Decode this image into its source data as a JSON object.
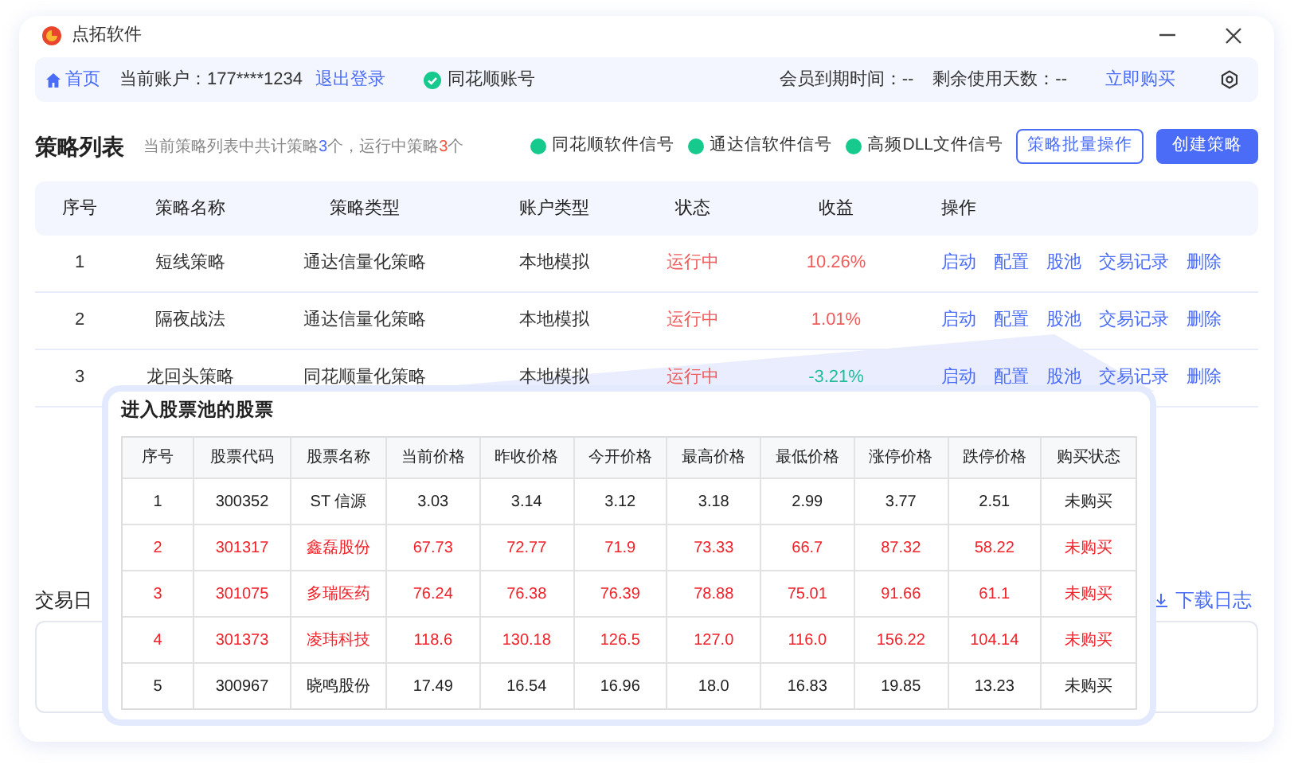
{
  "window": {
    "title": "点拓软件"
  },
  "nav": {
    "home": "首页",
    "account_label": "当前账户：",
    "account": "177****1234",
    "logout": "退出登录",
    "linked_account": "同花顺账号",
    "expiry": "会员到期时间：--",
    "remaining": "剩余使用天数：--",
    "buy": "立即购买"
  },
  "header": {
    "title": "策略列表",
    "summary": "当前策略列表中共计策略**3**个，运行中策略**3**个",
    "signals": [
      {
        "label": "同花顺软件信号",
        "color": "#16c98d"
      },
      {
        "label": "通达信软件信号",
        "color": "#16c98d"
      },
      {
        "label": "高频DLL文件信号",
        "color": "#16c98d"
      }
    ],
    "buttons": [
      "策略批量操作",
      "创建策略"
    ]
  },
  "table": {
    "columns": [
      "序号",
      "策略名称",
      "策略类型",
      "账户类型",
      "状态",
      "收益",
      "操作"
    ],
    "rows": [
      {
        "cells": [
          "1",
          "短线策略",
          "通达信量化策略",
          "本地模拟",
          "运行中",
          "10.26%"
        ],
        "color": "#f05b5b",
        "actions": [
          "启动",
          "配置",
          "股池",
          "交易记录",
          "删除"
        ]
      },
      {
        "cells": [
          "2",
          "隔夜战法",
          "通达信量化策略",
          "本地模拟",
          "运行中",
          "1.01%"
        ],
        "color": "#f05b5b",
        "actions": [
          "启动",
          "配置",
          "股池",
          "交易记录",
          "删除"
        ]
      },
      {
        "cells": [
          "3",
          "龙回头策略",
          "同花顺量化策略",
          "本地模拟",
          "运行中",
          "-3.21%"
        ],
        "color": "#1fbf9a",
        "actions": [
          "启动",
          "配置",
          "股池",
          "交易记录",
          "删除"
        ]
      }
    ]
  },
  "log": {
    "title": "交易日",
    "download": "下载日志"
  },
  "popover": {
    "title": "进入股票池的股票",
    "columns": [
      "序号",
      "股票代码",
      "股票名称",
      "当前价格",
      "昨收价格",
      "今开价格",
      "最高价格",
      "最低价格",
      "涨停价格",
      "跌停价格",
      "购买状态"
    ],
    "rows": [
      {
        "highlighted": false,
        "cells": [
          "1",
          "300352",
          "ST 信源",
          "3.03",
          "3.14",
          "3.12",
          "3.18",
          "2.99",
          "3.77",
          "2.51",
          "未购买"
        ]
      },
      {
        "highlighted": true,
        "cells": [
          "2",
          "301317",
          "鑫磊股份",
          "67.73",
          "72.77",
          "71.9",
          "73.33",
          "66.7",
          "87.32",
          "58.22",
          "未购买"
        ]
      },
      {
        "highlighted": true,
        "cells": [
          "3",
          "301075",
          "多瑞医药",
          "76.24",
          "76.38",
          "76.39",
          "78.88",
          "75.01",
          "91.66",
          "61.1",
          "未购买"
        ]
      },
      {
        "highlighted": true,
        "cells": [
          "4",
          "301373",
          "凌玮科技",
          "118.6",
          "130.18",
          "126.5",
          "127.0",
          "116.0",
          "156.22",
          "104.14",
          "未购买"
        ]
      },
      {
        "highlighted": false,
        "cells": [
          "5",
          "300967",
          "晓鸣股份",
          "17.49",
          "16.54",
          "16.96",
          "18.0",
          "16.83",
          "19.85",
          "13.23",
          "未购买"
        ]
      }
    ]
  }
}
